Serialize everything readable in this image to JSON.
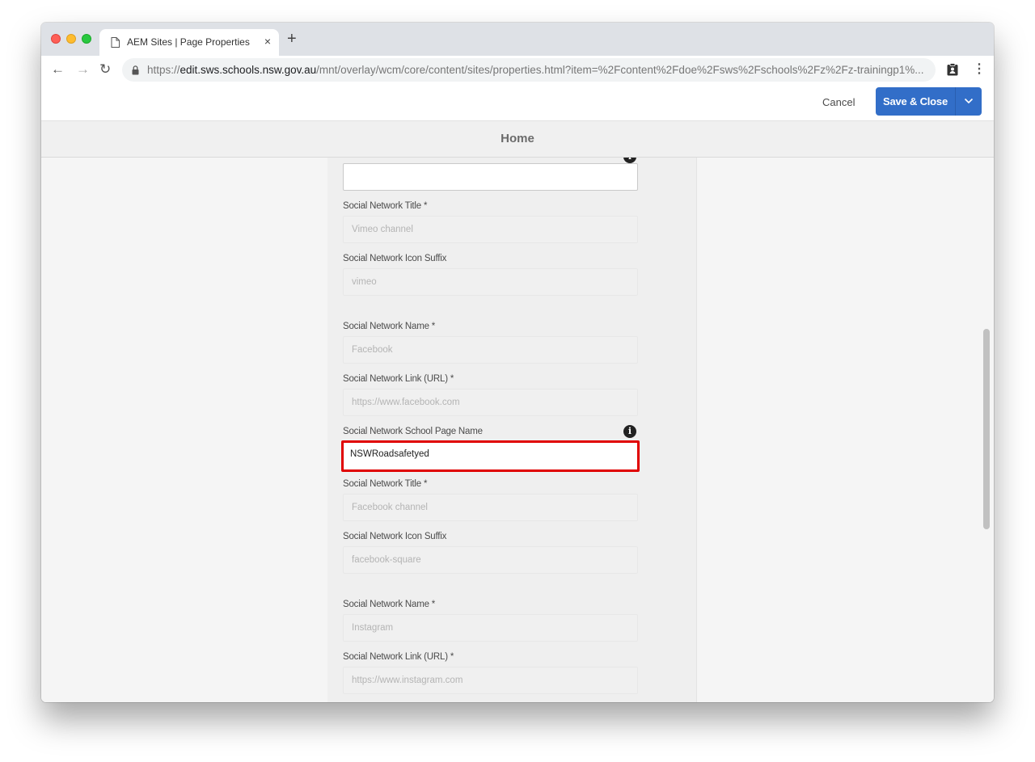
{
  "browser": {
    "tab_title": "AEM Sites | Page Properties",
    "tab_close": "×",
    "new_tab": "+",
    "url_scheme": "https://",
    "url_host": "edit.sws.schools.nsw.gov.au",
    "url_path": "/mnt/overlay/wcm/core/content/sites/properties.html?item=%2Fcontent%2Fdoe%2Fsws%2Fschools%2Fz%2Fz-trainingp1%..."
  },
  "header": {
    "cancel_label": "Cancel",
    "save_label": "Save & Close",
    "page_title": "Home"
  },
  "form": {
    "partial_field": {
      "value": ""
    },
    "vimeo": {
      "title_label": "Social Network Title *",
      "title_value": "Vimeo channel",
      "icon_label": "Social Network Icon Suffix",
      "icon_value": "vimeo"
    },
    "facebook": {
      "name_label": "Social Network Name *",
      "name_value": "Facebook",
      "link_label": "Social Network Link (URL) *",
      "link_value": "https://www.facebook.com",
      "page_label": "Social Network School Page Name",
      "page_value": "NSWRoadsafetyed",
      "title_label": "Social Network Title *",
      "title_value": "Facebook channel",
      "icon_label": "Social Network Icon Suffix",
      "icon_value": "facebook-square"
    },
    "instagram": {
      "name_label": "Social Network Name *",
      "name_value": "Instagram",
      "link_label": "Social Network Link (URL) *",
      "link_value": "https://www.instagram.com"
    }
  },
  "colors": {
    "primary_button": "#326ec8",
    "highlight_border": "#e00000"
  }
}
